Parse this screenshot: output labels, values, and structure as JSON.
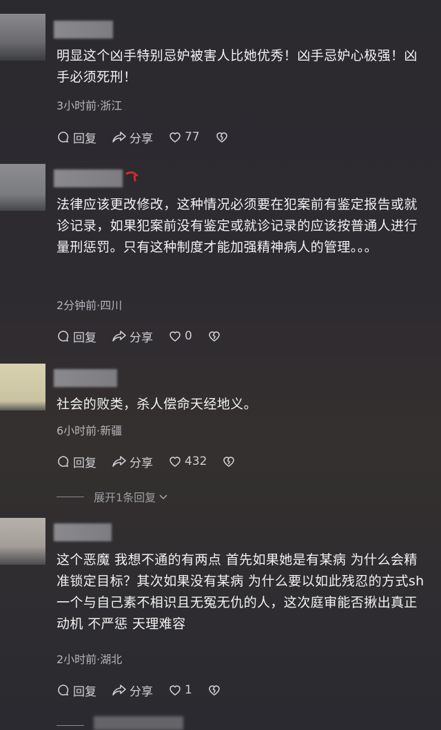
{
  "actions": {
    "reply": "回复",
    "share": "分享"
  },
  "comments": [
    {
      "text": "明显这个凶手特别忌妒被害人比她优秀！凶手忌妒心极强！凶手必须死刑！",
      "meta": "3小时前·浙江",
      "likes": "77"
    },
    {
      "text": "法律应该更改修改，这种情况必须要在犯案前有鉴定报告或就诊记录，如果犯案前没有鉴定或就诊记录的应该按普通人进行量刑惩罚。只有这种制度才能加强精神病人的管理。。。",
      "meta": "2分钟前·四川",
      "likes": "0"
    },
    {
      "text": "社会的败类，杀人偿命天经地义。",
      "meta": "6小时前·新疆",
      "likes": "432",
      "expand": "展开1条回复"
    },
    {
      "text": "这个恶魔 我想不通的有两点 首先如果她是有某病 为什么会精准锁定目标？其次如果没有某病 为什么要以如此残忍的方式sh一个与自己素不相识且无冤无仇的人，这次庭审能否揪出真正动机 不严惩 天理难容",
      "meta": "2小时前·湖北",
      "likes": "1"
    }
  ]
}
